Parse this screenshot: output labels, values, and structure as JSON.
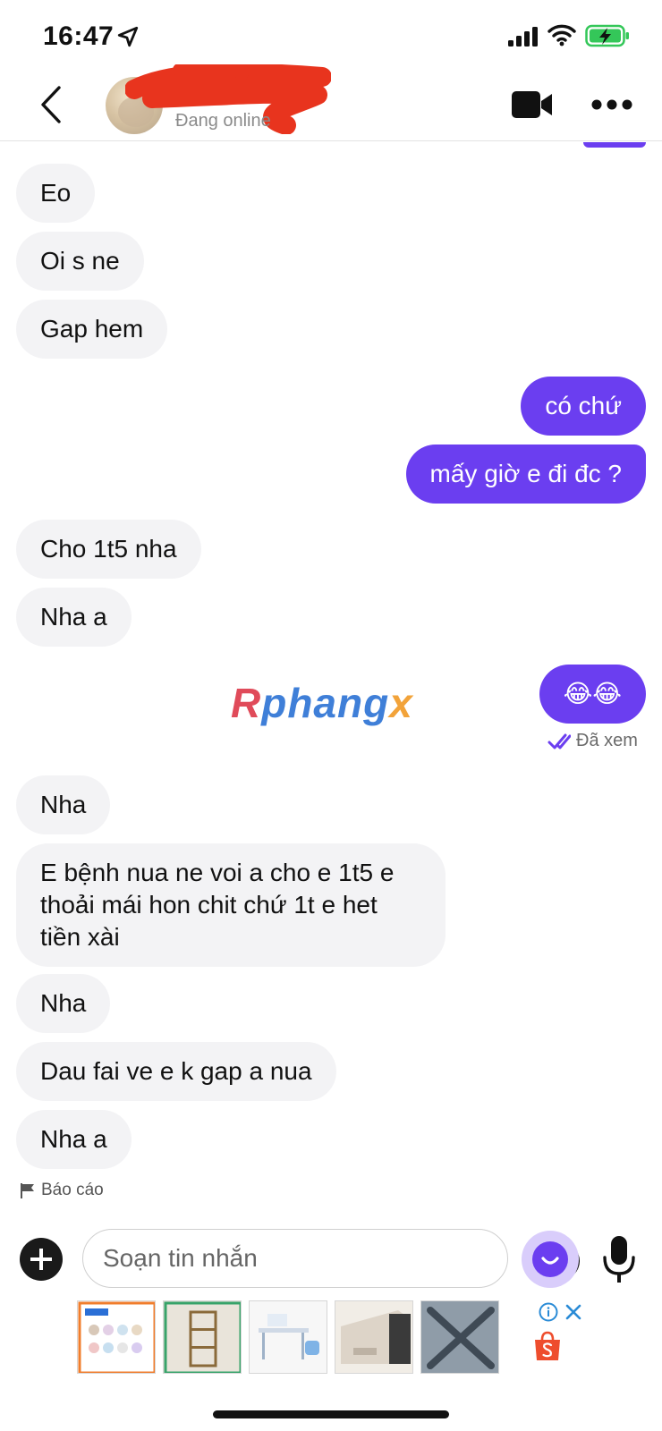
{
  "status_bar": {
    "time": "16:47",
    "icons": [
      "location-arrow-icon",
      "cellular-signal-icon",
      "wifi-icon",
      "battery-charging-icon"
    ]
  },
  "header": {
    "contact_status": "Đang online",
    "icons": [
      "back-chevron-icon",
      "video-camera-icon",
      "more-dots-icon"
    ],
    "name_redacted": true
  },
  "messages": [
    {
      "side": "in",
      "text": "Eo"
    },
    {
      "side": "in",
      "text": "Oi s ne"
    },
    {
      "side": "in",
      "text": "Gap hem"
    },
    {
      "side": "out",
      "text": "có chứ"
    },
    {
      "side": "out",
      "text": "mấy giờ e đi đc ?"
    },
    {
      "side": "in",
      "text": "Cho 1t5 nha"
    },
    {
      "side": "in",
      "text": "Nha a"
    },
    {
      "side": "out",
      "text": "😂😂"
    },
    {
      "side": "in",
      "text": "Nha"
    },
    {
      "side": "in",
      "text": "E bệnh nua ne voi a cho e 1t5 e thoải mái hon chit chứ 1t e het tiền xài"
    },
    {
      "side": "in",
      "text": "Nha"
    },
    {
      "side": "in",
      "text": "Dau fai ve e k gap a nua"
    },
    {
      "side": "in",
      "text": "Nha a"
    }
  ],
  "seen_label": "Đã xem",
  "report_label": "Báo cáo",
  "watermark": {
    "part1": "R",
    "part2": "phang",
    "part3": "x"
  },
  "composer": {
    "placeholder": "Soạn tin nhắn",
    "icons": [
      "plus-icon",
      "emoji-icon",
      "assistant-bot-icon",
      "microphone-icon"
    ]
  },
  "ad": {
    "thumbnails": 5,
    "icons": [
      "ad-info-icon",
      "ad-close-icon",
      "shopee-bag-icon"
    ]
  },
  "colors": {
    "accent": "#6b3ef0",
    "incoming_bubble": "#f3f3f5",
    "battery_green": "#34c759",
    "shopee_orange": "#ee4d2d"
  }
}
